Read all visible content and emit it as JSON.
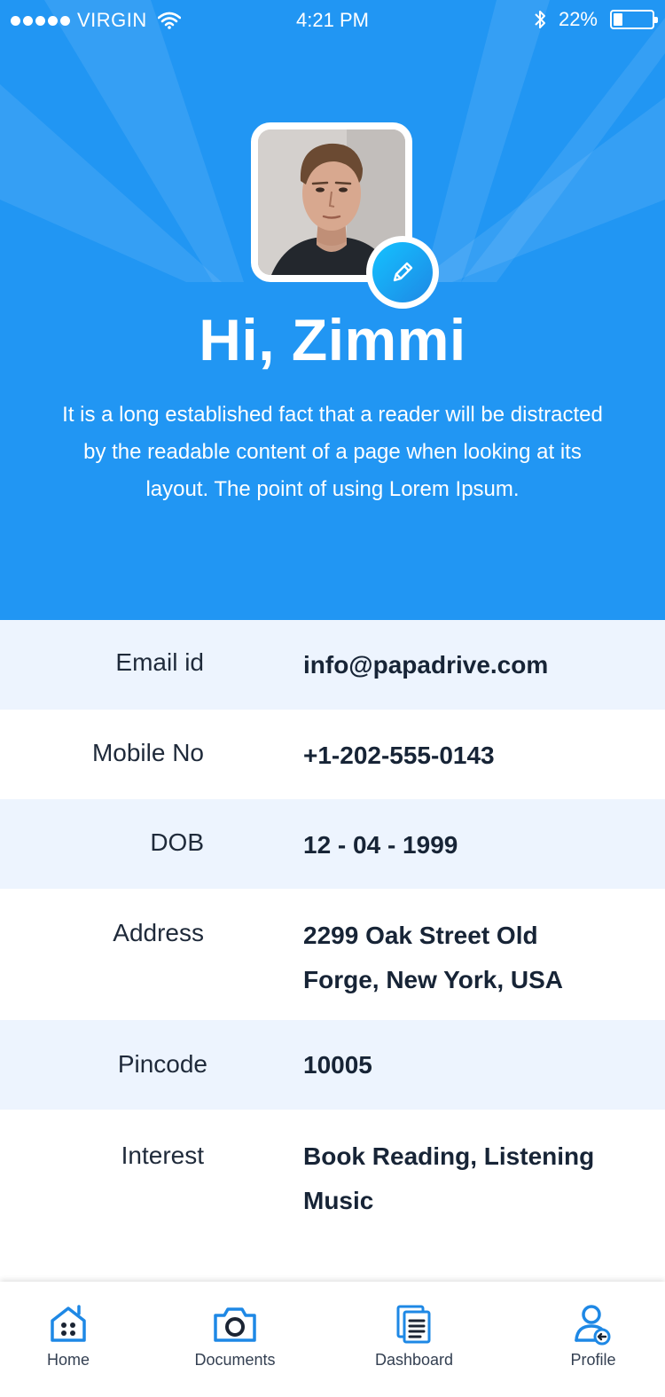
{
  "status_bar": {
    "carrier": "VIRGIN",
    "time": "4:21 PM",
    "battery_text": "22%",
    "battery_level": 0.22
  },
  "profile": {
    "greeting": "Hi, Zimmi",
    "intro": "It is a long established fact that a reader will be distracted by the readable content of a page when looking at its layout. The point of using Lorem Ipsum."
  },
  "details": [
    {
      "label": "Email id",
      "value": "info@papadrive.com"
    },
    {
      "label": "Mobile No",
      "value": "+1-202-555-0143"
    },
    {
      "label": "DOB",
      "value": "12 - 04 - 1999"
    },
    {
      "label": "Address",
      "value": "2299  Oak Street Old Forge, New York, USA"
    },
    {
      "label": "Pincode",
      "value": "10005"
    },
    {
      "label": "Interest",
      "value": "Book Reading, Listening Music"
    }
  ],
  "tabs": [
    {
      "label": "Home",
      "icon": "home-icon"
    },
    {
      "label": "Documents",
      "icon": "camera-icon"
    },
    {
      "label": "Dashboard",
      "icon": "document-stack-icon"
    },
    {
      "label": "Profile",
      "icon": "user-icon"
    }
  ],
  "colors": {
    "header_bg": "#2196f3",
    "row_alt_bg": "#edf4fe",
    "icon_blue": "#1e88e5"
  }
}
